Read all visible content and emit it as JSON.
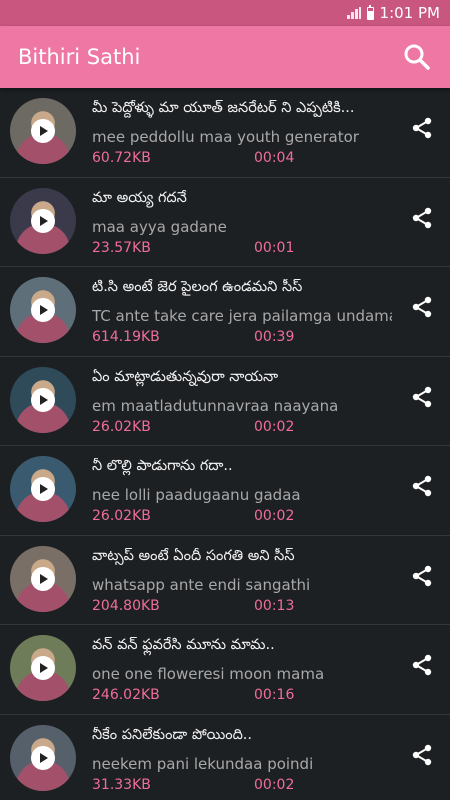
{
  "status_bar": {
    "time": "1:01 PM"
  },
  "app_bar": {
    "title": "Bithiri Sathi"
  },
  "theme": {
    "accent": "#ee77a4",
    "status_bar": "#c9567f",
    "background": "#1d2023",
    "meta_text": "#ef6d99"
  },
  "items": [
    {
      "title": "మీ పెద్దోళ్ళు మా యూత్ జనరేటర్ ని ఎప్పటికి...",
      "subtitle": "mee peddollu maa youth generator",
      "size": "60.72KB",
      "duration": "00:04",
      "avatar_color": "#6d6a63"
    },
    {
      "title": "మా అయ్య గదనే",
      "subtitle": "maa ayya gadane",
      "size": "23.57KB",
      "duration": "00:01",
      "avatar_color": "#3b3a4a"
    },
    {
      "title": "టి.సి అంటే జెర పైలంగ ఉండమని సీస్",
      "subtitle": "TC ante take care jera pailamga  undamani",
      "size": "614.19KB",
      "duration": "00:39",
      "avatar_color": "#5f6f7a"
    },
    {
      "title": "ఏం మాట్లాడుతున్నవురా నాయనా",
      "subtitle": "em maatladutunnavraa naayana",
      "size": "26.02KB",
      "duration": "00:02",
      "avatar_color": "#2f4b5a"
    },
    {
      "title": "నీ లొల్లి పాడుగాను గదా..",
      "subtitle": "nee lolli paadugaanu gadaa",
      "size": "26.02KB",
      "duration": "00:02",
      "avatar_color": "#3a5a70"
    },
    {
      "title": "వాట్సప్ అంటే ఏందీ సంగతి అని సీస్",
      "subtitle": "whatsapp ante endi sangathi",
      "size": "204.80KB",
      "duration": "00:13",
      "avatar_color": "#7a6f66"
    },
    {
      "title": "వన్ వన్ ఫ్లవరేసి మూను మామ..",
      "subtitle": "one one floweresi moon mama",
      "size": "246.02KB",
      "duration": "00:16",
      "avatar_color": "#6f7c5a"
    },
    {
      "title": "నీకేం పనిలేకుండా పోయింది..",
      "subtitle": "neekem pani lekundaa poindi",
      "size": "31.33KB",
      "duration": "00:02",
      "avatar_color": "#55606a"
    }
  ]
}
